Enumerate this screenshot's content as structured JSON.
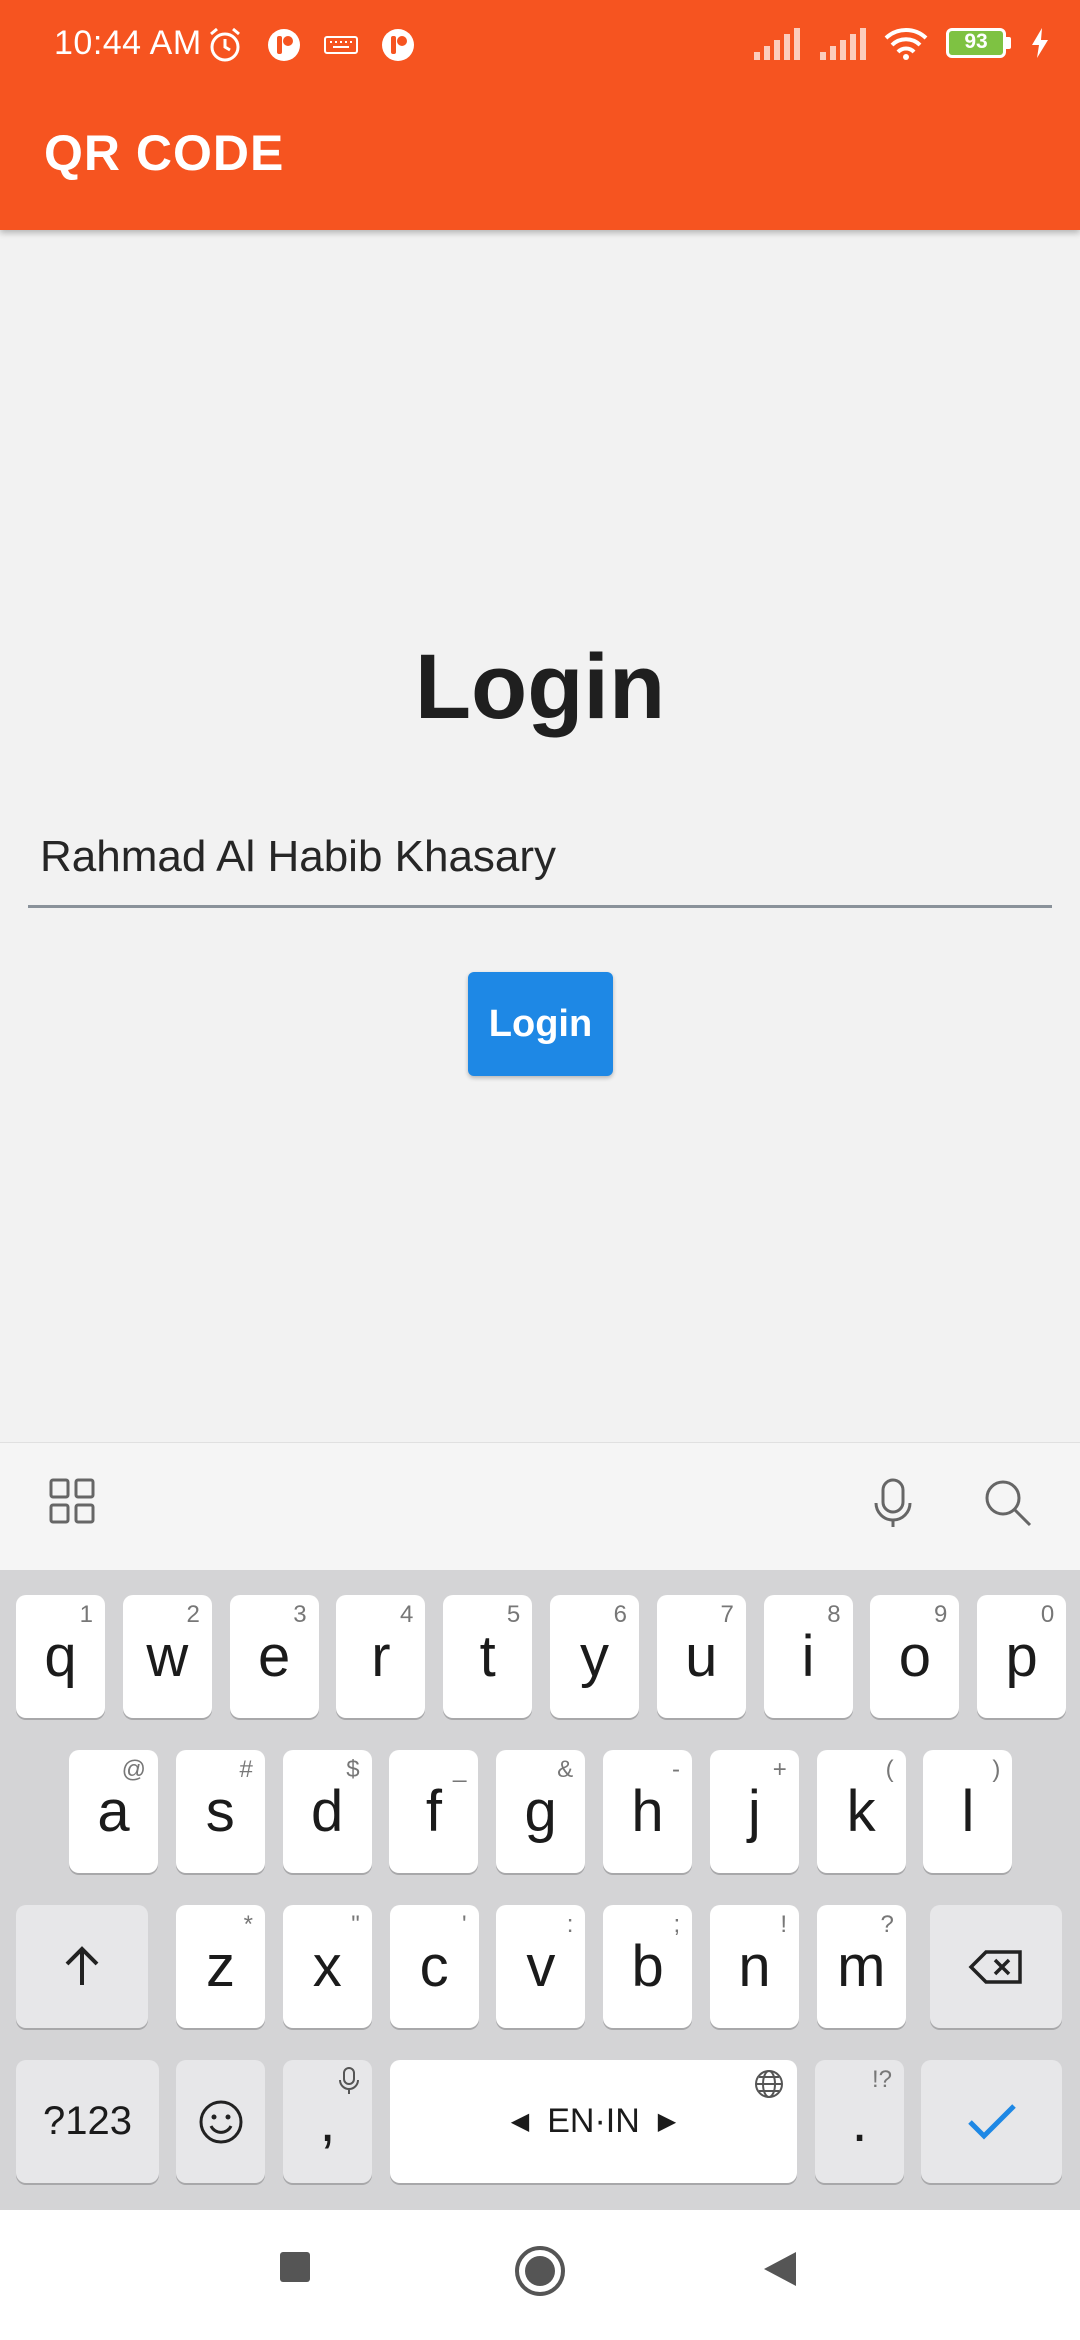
{
  "status_bar": {
    "time": "10:44 AM",
    "battery": "93",
    "icons_left": [
      "alarm-icon",
      "app-notification-icon",
      "keyboard-icon",
      "app-notification-icon"
    ],
    "icons_right": [
      "signal-icon",
      "signal-icon",
      "wifi-icon",
      "battery-icon",
      "charging-icon"
    ]
  },
  "app_bar": {
    "title": "QR CODE"
  },
  "main": {
    "heading": "Login",
    "name_field_value": "Rahmad Al Habib Khasary",
    "login_button": "Login"
  },
  "keyboard_toolbar": {
    "icons": [
      "apps-grid-icon",
      "microphone-icon",
      "search-icon"
    ]
  },
  "keyboard": {
    "row1": [
      {
        "k": "q",
        "h": "1"
      },
      {
        "k": "w",
        "h": "2"
      },
      {
        "k": "e",
        "h": "3"
      },
      {
        "k": "r",
        "h": "4"
      },
      {
        "k": "t",
        "h": "5"
      },
      {
        "k": "y",
        "h": "6"
      },
      {
        "k": "u",
        "h": "7"
      },
      {
        "k": "i",
        "h": "8"
      },
      {
        "k": "o",
        "h": "9"
      },
      {
        "k": "p",
        "h": "0"
      }
    ],
    "row2": [
      {
        "k": "a",
        "h": "@"
      },
      {
        "k": "s",
        "h": "#"
      },
      {
        "k": "d",
        "h": "$"
      },
      {
        "k": "f",
        "h": "_"
      },
      {
        "k": "g",
        "h": "&"
      },
      {
        "k": "h",
        "h": "-"
      },
      {
        "k": "j",
        "h": "+"
      },
      {
        "k": "k",
        "h": "("
      },
      {
        "k": "l",
        "h": ")"
      }
    ],
    "row3": [
      {
        "k": "z",
        "h": "*"
      },
      {
        "k": "x",
        "h": "\""
      },
      {
        "k": "c",
        "h": "'"
      },
      {
        "k": "v",
        "h": ":"
      },
      {
        "k": "b",
        "h": ";"
      },
      {
        "k": "n",
        "h": "!"
      },
      {
        "k": "m",
        "h": "?"
      }
    ],
    "symbols_key": "?123",
    "comma_key": ",",
    "space_label": "EN·IN",
    "period_key": ".",
    "period_hint": "!?"
  },
  "nav_bar": {
    "icons": [
      "recents-square-icon",
      "home-circle-icon",
      "back-triangle-icon"
    ]
  }
}
